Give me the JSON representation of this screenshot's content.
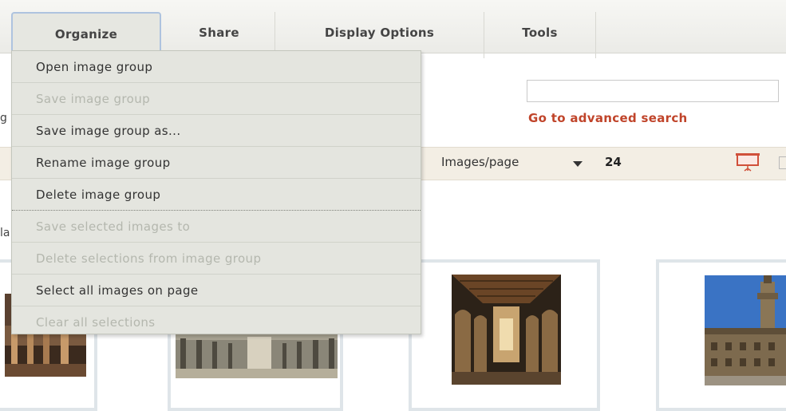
{
  "menubar": {
    "tabs": [
      {
        "label": "Organize"
      },
      {
        "label": "Share"
      },
      {
        "label": "Display Options"
      },
      {
        "label": "Tools"
      }
    ]
  },
  "organize_menu": {
    "items": [
      {
        "label": "Open image group",
        "enabled": true
      },
      {
        "label": "Save image group",
        "enabled": false
      },
      {
        "label": "Save image group as...",
        "enabled": true
      },
      {
        "label": "Rename image group",
        "enabled": true
      },
      {
        "label": "Delete image group",
        "enabled": true
      },
      {
        "label": "Save selected images to",
        "enabled": false
      },
      {
        "label": "Delete selections from image group",
        "enabled": false
      },
      {
        "label": "Select all images on page",
        "enabled": true
      },
      {
        "label": "Clear all selections",
        "enabled": false
      }
    ]
  },
  "search": {
    "value": "",
    "advanced_link": "Go to advanced search"
  },
  "left_clipped": {
    "text1": "g",
    "text2": "la"
  },
  "pagination": {
    "images_per_page_label": "Images/page",
    "images_per_page_value": "24"
  },
  "icons": {
    "presentation": "presentation-screen-icon",
    "dropdown_arrow": "triangle-down-icon"
  },
  "colors": {
    "accent_link": "#c0442a",
    "menu_bg": "#e4e5df",
    "toolbar_bg": "#f3eee4",
    "tab_active_border": "#aec3df"
  }
}
